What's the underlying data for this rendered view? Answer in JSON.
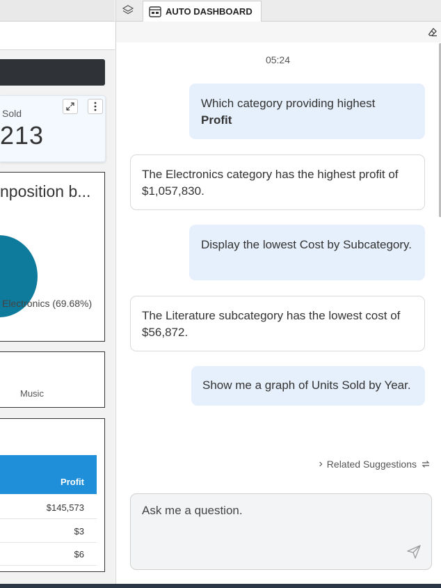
{
  "left": {
    "kpi": {
      "label": "Sold",
      "value": "213"
    },
    "composition_chart": {
      "title": "nposition b...",
      "slice_label": "Electronics (69.68%)",
      "slice_color": "#0e7a9c"
    },
    "music_card": {
      "label": "Music"
    },
    "table": {
      "header": "Profit",
      "header_color": "#1e8fd8",
      "rows": [
        "$145,573",
        "$3",
        "$6"
      ]
    }
  },
  "right": {
    "tab_label": "AUTO DASHBOARD",
    "timestamp": "05:24",
    "messages": [
      {
        "role": "user",
        "text": "Which category providing highest",
        "bold": "Profit"
      },
      {
        "role": "bot",
        "text": "The Electronics category has the highest profit of $1,057,830."
      },
      {
        "role": "user",
        "text": "Display the lowest Cost by Subcategory."
      },
      {
        "role": "bot",
        "text": "The Literature subcategory has the lowest cost of $56,872."
      },
      {
        "role": "user",
        "text": "Show me a graph of Units Sold by Year."
      }
    ],
    "related_suggestions": "Related Suggestions",
    "input_placeholder": "Ask me a question."
  }
}
